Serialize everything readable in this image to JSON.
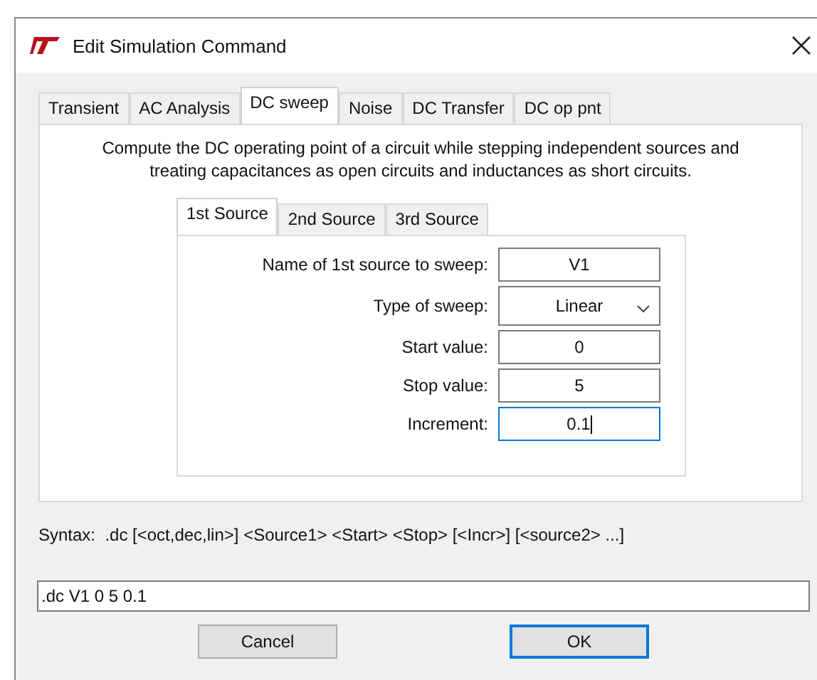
{
  "window": {
    "title": "Edit Simulation Command"
  },
  "tabs": [
    {
      "label": "Transient",
      "selected": false
    },
    {
      "label": "AC Analysis",
      "selected": false
    },
    {
      "label": "DC sweep",
      "selected": true
    },
    {
      "label": "Noise",
      "selected": false
    },
    {
      "label": "DC Transfer",
      "selected": false
    },
    {
      "label": "DC op pnt",
      "selected": false
    }
  ],
  "description": "Compute the DC operating point of a circuit while stepping independent sources and treating capacitances as open circuits and inductances as short circuits.",
  "source_tabs": [
    {
      "label": "1st Source",
      "selected": true
    },
    {
      "label": "2nd Source",
      "selected": false
    },
    {
      "label": "3rd Source",
      "selected": false
    }
  ],
  "fields": [
    {
      "kind": "text",
      "label": "Name of 1st source to sweep:",
      "value": "V1",
      "focused": false
    },
    {
      "kind": "select",
      "label": "Type of sweep:",
      "value": "Linear",
      "focused": false
    },
    {
      "kind": "text",
      "label": "Start value:",
      "value": "0",
      "focused": false
    },
    {
      "kind": "text",
      "label": "Stop value:",
      "value": "5",
      "focused": false
    },
    {
      "kind": "text",
      "label": "Increment:",
      "value": "0.1",
      "focused": true
    }
  ],
  "syntax": "Syntax:  .dc [<oct,dec,lin>] <Source1> <Start> <Stop> [<Incr>] [<source2> ...]",
  "command": ".dc V1 0 5 0.1",
  "buttons": [
    {
      "label": "Cancel",
      "default": false
    },
    {
      "label": "OK",
      "default": true
    }
  ]
}
